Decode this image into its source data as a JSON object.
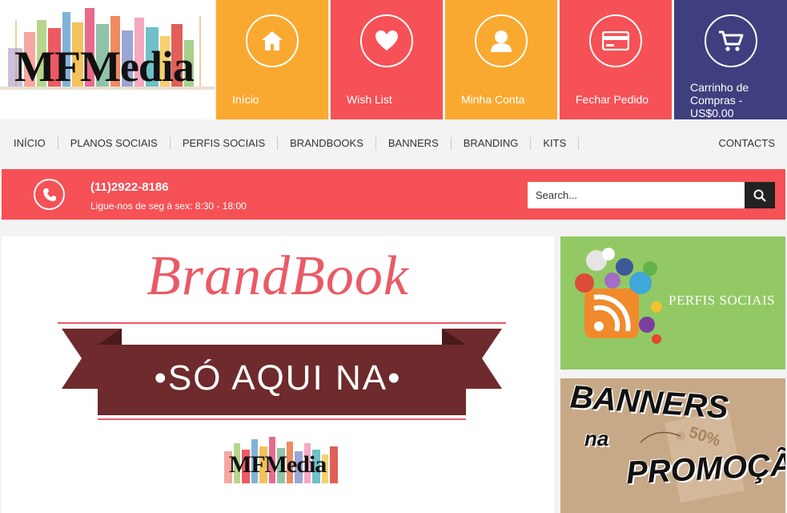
{
  "logo": {
    "text": "MFMedia"
  },
  "tiles": [
    {
      "label": "Início",
      "icon": "home-icon",
      "color": "#f9a930"
    },
    {
      "label": "Wish List",
      "icon": "heart-icon",
      "color": "#f55156"
    },
    {
      "label": "Minha Conta",
      "icon": "user-icon",
      "color": "#f9a930"
    },
    {
      "label": "Fechar Pedido",
      "icon": "credit-card-icon",
      "color": "#f55156"
    },
    {
      "label": "Carrinho de Compras - US$0.00",
      "icon": "cart-icon",
      "color": "#3f3f7f"
    }
  ],
  "nav": {
    "items": [
      "INÍCIO",
      "PLANOS SOCIAIS",
      "PERFIS SOCIAIS",
      "BRANDBOOKS",
      "BANNERS",
      "BRANDING",
      "KITS"
    ],
    "contacts": "CONTACTS"
  },
  "contact": {
    "phone": "(11)2922-8186",
    "hours": "Ligue-nos de seg à sex: 8:30  - 18:00",
    "search_placeholder": "Search..."
  },
  "main_banner": {
    "title": "BrandBook",
    "ribbon": "•SÓ AQUI NA•",
    "logo": "MFMedia"
  },
  "side_banners": {
    "perfis": "PERFIS SOCIAIS",
    "banners_line1": "BANNERS",
    "banners_line2": "na",
    "banners_line3": "PROMOÇÃO",
    "tag": "50%"
  },
  "colors": {
    "orange": "#f9a930",
    "red": "#f55156",
    "navy": "#3f3f7f",
    "green": "#92c965",
    "tan": "#c7a987",
    "ribbon": "#6e2a2c"
  }
}
